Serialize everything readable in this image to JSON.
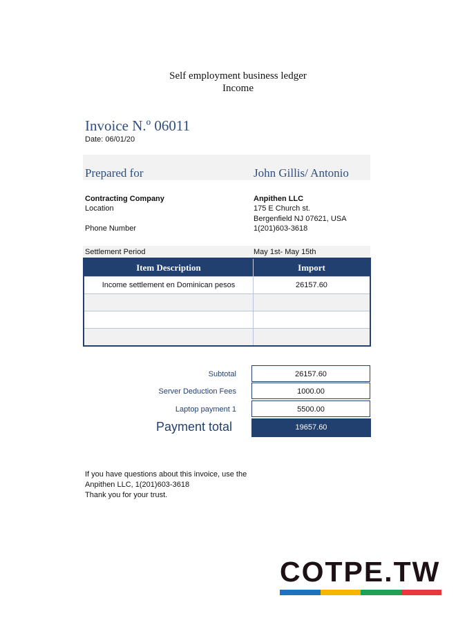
{
  "header": {
    "title": "Self employment business ledger",
    "subtitle": "Income"
  },
  "invoice": {
    "number_label": "Invoice N.º 06011",
    "date": "Date: 06/01/20"
  },
  "prepared": {
    "label": "Prepared for",
    "name": "John Gillis/ Antonio"
  },
  "client": {
    "company": "Contracting Company",
    "location": "Location",
    "phone_label": "Phone Number"
  },
  "vendor": {
    "name": "Anpithen LLC",
    "address1": "175 E Church st.",
    "address2": "Bergenfield NJ 07621, USA",
    "phone": "1(201)603-3618"
  },
  "settlement": {
    "label": "Settlement Period",
    "value": "May 1st- May 15th"
  },
  "table": {
    "headers": [
      "Item Description",
      "Import"
    ],
    "rows": [
      [
        "Income settlement en Dominican pesos",
        "26157.60"
      ],
      [
        "",
        ""
      ],
      [
        "",
        ""
      ],
      [
        "",
        ""
      ]
    ]
  },
  "totals": {
    "subtotal_label": "Subtotal",
    "subtotal": "26157.60",
    "fees_label": "Server Deduction Fees",
    "fees": "1000.00",
    "laptop_label": "Laptop payment 1",
    "laptop": "5500.00",
    "payment_label": "Payment total",
    "payment": "19657.60"
  },
  "footer": {
    "line1": "If you have questions about this invoice, use the",
    "line2": "Anpithen LLC, 1(201)603-3618",
    "line3": "Thank you for your trust."
  },
  "logo": {
    "text": "COTPE.TW",
    "colors": [
      "#1e73be",
      "#f7b500",
      "#1fa055",
      "#e8383d"
    ]
  },
  "colors": {
    "accent": "#213f6f",
    "heading": "#2d4e7f",
    "band": "#f2f2f2"
  }
}
